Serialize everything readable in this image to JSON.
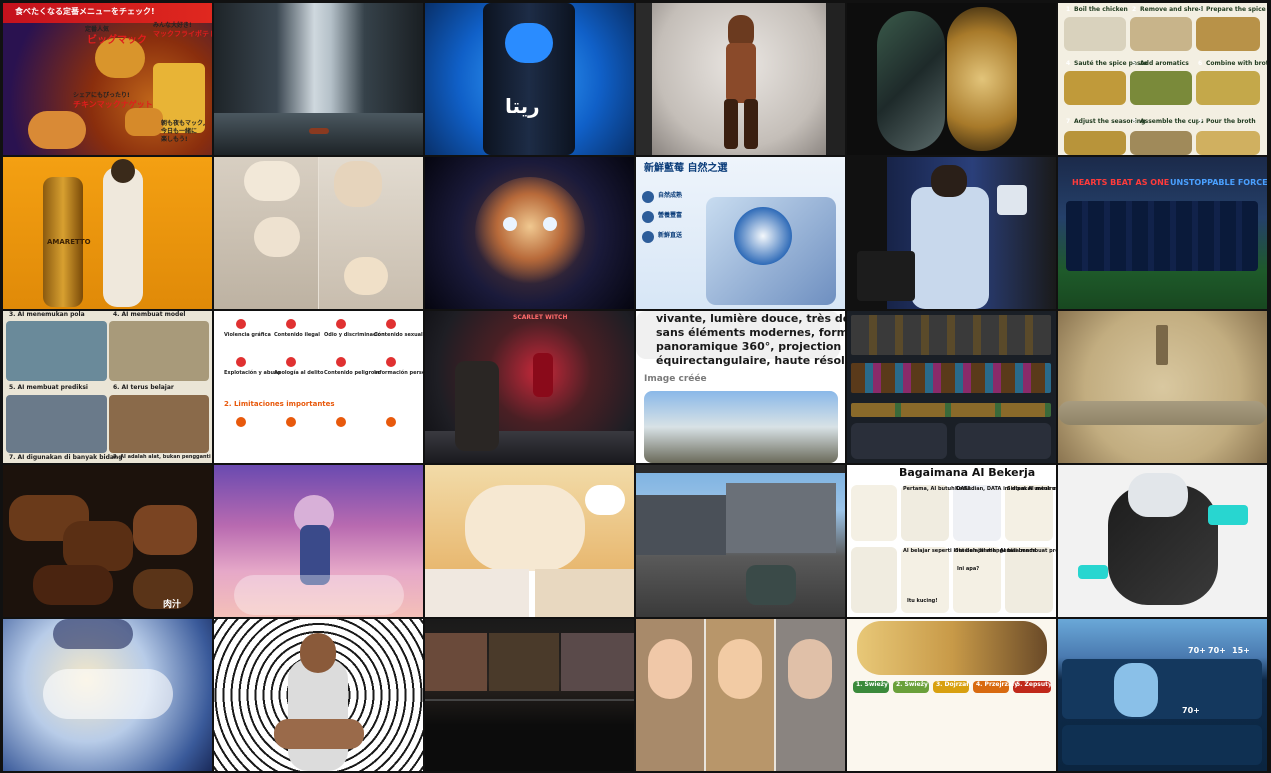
{
  "gallery": {
    "tiles": [
      {
        "key": "burger",
        "texts": [
          {
            "text": "食べたくなる定番メニューをチェック!",
            "color": "#ffffff"
          },
          {
            "text": "定番人気",
            "color": "#222222"
          },
          {
            "text": "ビッグマック",
            "color": "#e11d1d"
          },
          {
            "text": "みんな大好き!",
            "color": "#222222"
          },
          {
            "text": "マックフライポテト",
            "color": "#e11d1d"
          },
          {
            "text": "シェアにもぴったり!",
            "color": "#222222"
          },
          {
            "text": "チキンマックナゲット",
            "color": "#e11d1d"
          },
          {
            "text": "朝も夜もマック,",
            "color": "#222222"
          },
          {
            "text": "今日も一緒に",
            "color": "#222222"
          },
          {
            "text": "楽しもう!",
            "color": "#222222"
          }
        ]
      },
      {
        "key": "waterfall",
        "texts": []
      },
      {
        "key": "can",
        "texts": [
          {
            "text": "ريتا",
            "color": "#ffffff"
          }
        ]
      },
      {
        "key": "warrior",
        "texts": []
      },
      {
        "key": "abalone",
        "texts": []
      },
      {
        "key": "recipe",
        "texts": [
          {
            "text": "1",
            "color": "#ffffff"
          },
          {
            "text": "Boil the chicken",
            "color": "#1f3a1f"
          },
          {
            "text": "2",
            "color": "#ffffff"
          },
          {
            "text": "Remove and shred",
            "color": "#1f3a1f"
          },
          {
            "text": "3",
            "color": "#ffffff"
          },
          {
            "text": "Prepare the spice paste",
            "color": "#1f3a1f"
          },
          {
            "text": "4",
            "color": "#ffffff"
          },
          {
            "text": "Sauté the spice paste",
            "color": "#1f3a1f"
          },
          {
            "text": "5",
            "color": "#ffffff"
          },
          {
            "text": "Add aromatics",
            "color": "#1f3a1f"
          },
          {
            "text": "6",
            "color": "#ffffff"
          },
          {
            "text": "Combine with broth",
            "color": "#1f3a1f"
          },
          {
            "text": "7",
            "color": "#ffffff"
          },
          {
            "text": "Adjust the seasoning",
            "color": "#1f3a1f"
          },
          {
            "text": "8",
            "color": "#ffffff"
          },
          {
            "text": "Assemble the cups",
            "color": "#1f3a1f"
          },
          {
            "text": "9",
            "color": "#ffffff"
          },
          {
            "text": "Pour the broth",
            "color": "#1f3a1f"
          }
        ]
      },
      {
        "key": "amaretto",
        "texts": [
          {
            "text": "AMARETTO",
            "color": "#3b2104"
          }
        ]
      },
      {
        "key": "dogs",
        "texts": []
      },
      {
        "key": "owl",
        "texts": []
      },
      {
        "key": "blueberry",
        "texts": [
          {
            "text": "新鮮藍莓 自然之選",
            "color": "#0b3d7a"
          },
          {
            "text": "自然成熟",
            "color": "#0b3d7a"
          },
          {
            "text": "營養豐富",
            "color": "#0b3d7a"
          },
          {
            "text": "新鮮直送",
            "color": "#0b3d7a"
          }
        ]
      },
      {
        "key": "fashion",
        "texts": []
      },
      {
        "key": "football",
        "texts": [
          {
            "text": "HEARTS BEAT AS ONE",
            "color": "#ff3b3b"
          },
          {
            "text": "UNSTOPPABLE FORCE",
            "color": "#4aa0ff"
          }
        ]
      },
      {
        "key": "ai-comic",
        "texts": [
          {
            "text": "3. AI menemukan pola",
            "color": "#1b1b1b"
          },
          {
            "text": "4. AI membuat model",
            "color": "#1b1b1b"
          },
          {
            "text": "5. AI membuat prediksi",
            "color": "#1b1b1b"
          },
          {
            "text": "6. AI terus belajar",
            "color": "#1b1b1b"
          },
          {
            "text": "7. AI digunakan di banyak bidang",
            "color": "#1b1b1b"
          },
          {
            "text": "8. AI adalah alat, bukan pengganti manusia",
            "color": "#1b1b1b"
          }
        ]
      },
      {
        "key": "policy",
        "texts": [
          {
            "text": "Violencia gráfica",
            "color": "#222222"
          },
          {
            "text": "Contenido ilegal",
            "color": "#222222"
          },
          {
            "text": "Odio y discriminación",
            "color": "#222222"
          },
          {
            "text": "Contenido sexual explícito",
            "color": "#222222"
          },
          {
            "text": "Explotación y abuso",
            "color": "#222222"
          },
          {
            "text": "Apología al delito",
            "color": "#222222"
          },
          {
            "text": "Contenido peligroso",
            "color": "#222222"
          },
          {
            "text": "Información personal",
            "color": "#222222"
          },
          {
            "text": "2. Limitaciones importantes",
            "color": "#e8590c"
          }
        ]
      },
      {
        "key": "scarlet",
        "texts": [
          {
            "text": "SCARLET WITCH",
            "color": "#ff6b6b"
          }
        ]
      },
      {
        "key": "chat",
        "texts": [
          {
            "text": "vivante, lumière douce, très détaillé,",
            "color": "#1a1a1a"
          },
          {
            "text": "sans éléments modernes, format",
            "color": "#1a1a1a"
          },
          {
            "text": "panoramique 360°, projection",
            "color": "#1a1a1a"
          },
          {
            "text": "équirectangulaire, haute résolution.",
            "color": "#1a1a1a"
          },
          {
            "text": "Image créée",
            "color": "#7a7a7a"
          }
        ]
      },
      {
        "key": "game-icons",
        "texts": []
      },
      {
        "key": "old-map",
        "texts": []
      },
      {
        "key": "chocolate",
        "texts": [
          {
            "text": "肉汁",
            "color": "#ffffff"
          }
        ]
      },
      {
        "key": "anime-sky",
        "texts": []
      },
      {
        "key": "manga",
        "texts": []
      },
      {
        "key": "street",
        "texts": []
      },
      {
        "key": "bagaimana",
        "texts": [
          {
            "text": "Bagaimana AI Bekerja",
            "color": "#111111"
          },
          {
            "text": "Pertama, AI butuh DATA.",
            "color": "#111111"
          },
          {
            "text": "Kemudian, DATA ini dipakai untuk melatih MODEL.",
            "color": "#111111"
          },
          {
            "text": "Sistem AI meniru cara kita",
            "color": "#111111"
          },
          {
            "text": "AI belajar seperti kita belajar mengenali benda.",
            "color": "#111111"
          },
          {
            "text": "Setelah dilatih, AI bisa membuat prediksi atau jawaban.",
            "color": "#111111"
          },
          {
            "text": "Ini apa?",
            "color": "#111111"
          },
          {
            "text": "Itu kucing!",
            "color": "#111111"
          }
        ]
      },
      {
        "key": "silver-anime",
        "texts": []
      },
      {
        "key": "dream",
        "texts": []
      },
      {
        "key": "doodle",
        "texts": []
      },
      {
        "key": "concert",
        "texts": []
      },
      {
        "key": "ages",
        "texts": []
      },
      {
        "key": "potato",
        "texts": [
          {
            "text": "1. Świeży",
            "color": "#ffffff"
          },
          {
            "text": "2. Świeży",
            "color": "#ffffff"
          },
          {
            "text": "3. Dojrzały",
            "color": "#ffffff"
          },
          {
            "text": "4. Przejrzały",
            "color": "#ffffff"
          },
          {
            "text": "5. Zepsuty",
            "color": "#ffffff"
          }
        ]
      },
      {
        "key": "airport",
        "texts": [
          {
            "text": "70+",
            "color": "#ffffff"
          },
          {
            "text": "70+",
            "color": "#ffffff"
          },
          {
            "text": "15+",
            "color": "#ffffff"
          },
          {
            "text": "70+",
            "color": "#ffffff"
          }
        ]
      }
    ]
  }
}
